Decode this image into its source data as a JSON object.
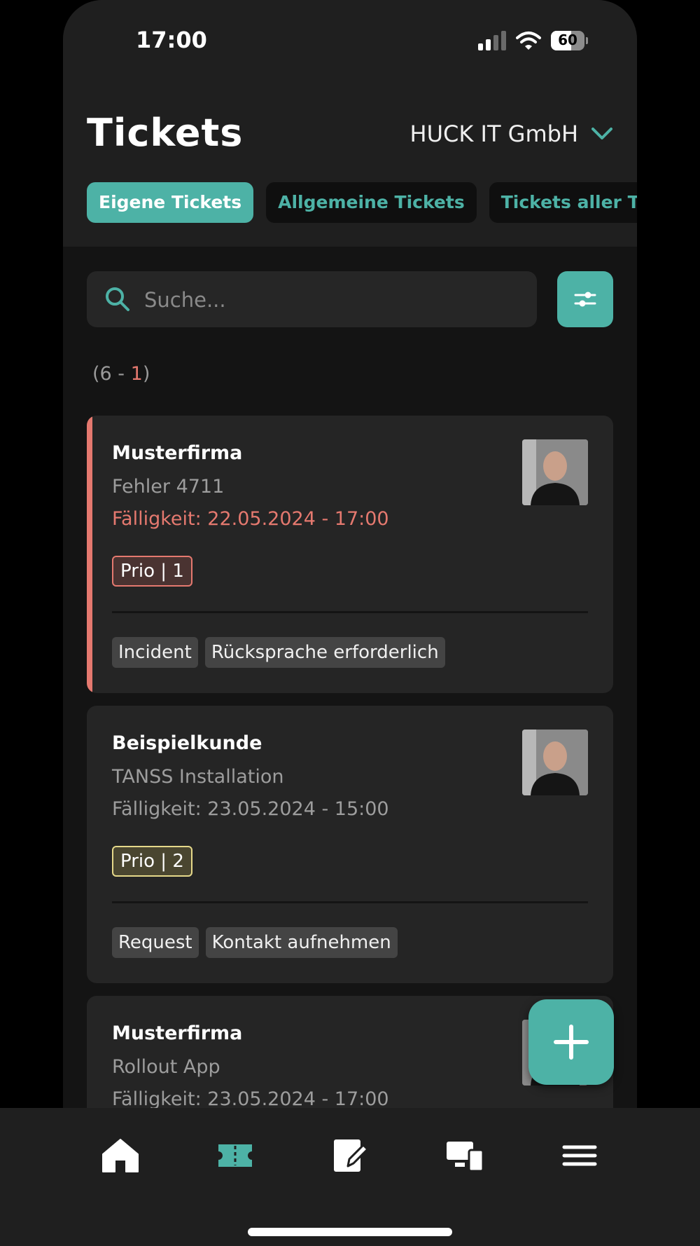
{
  "status_bar": {
    "time": "17:00",
    "battery": "60",
    "battery_level": 0.6
  },
  "header": {
    "title": "Tickets",
    "company": "HUCK IT GmbH"
  },
  "tabs": [
    {
      "label": "Eigene Tickets",
      "active": true
    },
    {
      "label": "Allgemeine Tickets",
      "active": false
    },
    {
      "label": "Tickets aller Tec",
      "active": false
    }
  ],
  "search": {
    "placeholder": "Suche..."
  },
  "count": {
    "open": "(6 - ",
    "overdue": "1",
    "close": ")"
  },
  "tickets": [
    {
      "company": "Musterfirma",
      "subject": "Fehler 4711",
      "due": "Fälligkeit: 22.05.2024 - 17:00",
      "overdue": true,
      "priority": "Prio | 1",
      "tags": [
        "Incident",
        "Rücksprache erforderlich"
      ]
    },
    {
      "company": "Beispielkunde",
      "subject": "TANSS Installation",
      "due": "Fälligkeit: 23.05.2024 - 15:00",
      "overdue": false,
      "priority": "Prio | 2",
      "tags": [
        "Request",
        "Kontakt aufnehmen"
      ]
    },
    {
      "company": "Musterfirma",
      "subject": "Rollout App",
      "due": "Fälligkeit: 23.05.2024 - 17:00",
      "overdue": false
    }
  ],
  "nav": [
    "home-icon",
    "ticket-icon",
    "edit-icon",
    "devices-icon",
    "menu-icon"
  ],
  "colors": {
    "accent": "#4db2a6",
    "overdue": "#e5796f",
    "prio2": "#e6d98a",
    "background": "#141414",
    "card": "#252525"
  }
}
